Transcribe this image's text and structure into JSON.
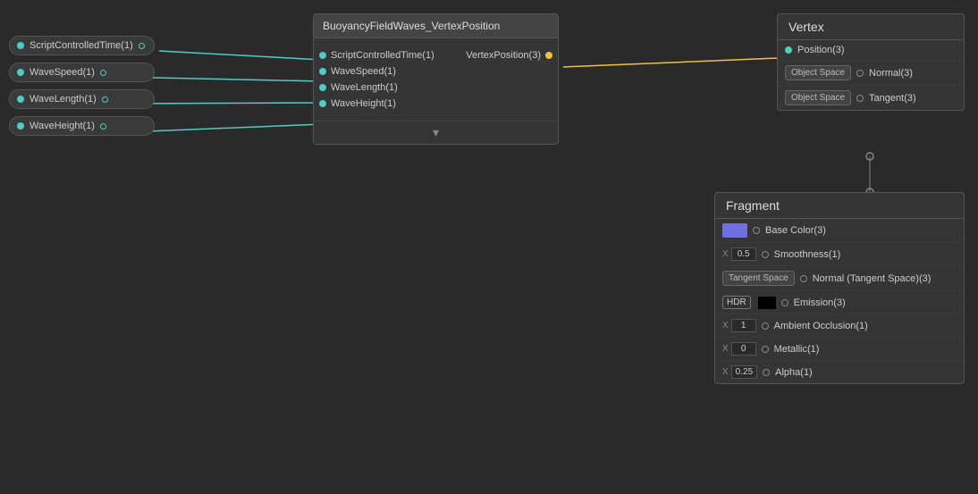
{
  "inputNodes": [
    {
      "id": "script-controlled-time",
      "label": "ScriptControlledTime(1)"
    },
    {
      "id": "wave-speed",
      "label": "WaveSpeed(1)"
    },
    {
      "id": "wave-length",
      "label": "WaveLength(1)"
    },
    {
      "id": "wave-height",
      "label": "WaveHeight(1)"
    }
  ],
  "centralNode": {
    "title": "BuoyancyFieldWaves_VertexPosition",
    "inputs": [
      "ScriptControlledTime(1)",
      "WaveSpeed(1)",
      "WaveLength(1)",
      "WaveHeight(1)"
    ],
    "outputs": [
      {
        "label": "VertexPosition(3)"
      }
    ],
    "footer": "chevron-down"
  },
  "vertexPanel": {
    "title": "Vertex",
    "rows": [
      {
        "label": "Position(3)",
        "hasSpaceBadge": false,
        "connected": true
      },
      {
        "label": "Normal(3)",
        "hasSpaceBadge": true,
        "spaceBadgeText": "Object Space",
        "connected": false
      },
      {
        "label": "Tangent(3)",
        "hasSpaceBadge": true,
        "spaceBadgeText": "Object Space",
        "connected": false
      }
    ]
  },
  "fragmentPanel": {
    "title": "Fragment",
    "rows": [
      {
        "label": "Base Color(3)",
        "inputType": "color",
        "colorValue": "#7070e0",
        "connected": false
      },
      {
        "label": "Smoothness(1)",
        "inputType": "number",
        "numPrefix": "X",
        "numValue": "0.5",
        "connected": false
      },
      {
        "label": "Normal (Tangent Space)(3)",
        "inputType": "badge",
        "badgeText": "Tangent Space",
        "connected": false
      },
      {
        "label": "Emission(3)",
        "inputType": "hdr",
        "connected": false
      },
      {
        "label": "Ambient Occlusion(1)",
        "inputType": "number",
        "numPrefix": "X",
        "numValue": "1",
        "connected": false
      },
      {
        "label": "Metallic(1)",
        "inputType": "number",
        "numPrefix": "X",
        "numValue": "0",
        "connected": false
      },
      {
        "label": "Alpha(1)",
        "inputType": "number",
        "numPrefix": "X",
        "numValue": "0.25",
        "connected": false
      }
    ]
  },
  "colors": {
    "teal": "#4ecdc4",
    "yellow": "#f0c040",
    "background": "#2a2a2a",
    "nodeBackground": "#353535",
    "headerBackground": "#444",
    "border": "#555",
    "colorSwatch": "#7070e0"
  },
  "labels": {
    "chevronDown": "▾",
    "vertexTitle": "Vertex",
    "fragmentTitle": "Fragment"
  }
}
